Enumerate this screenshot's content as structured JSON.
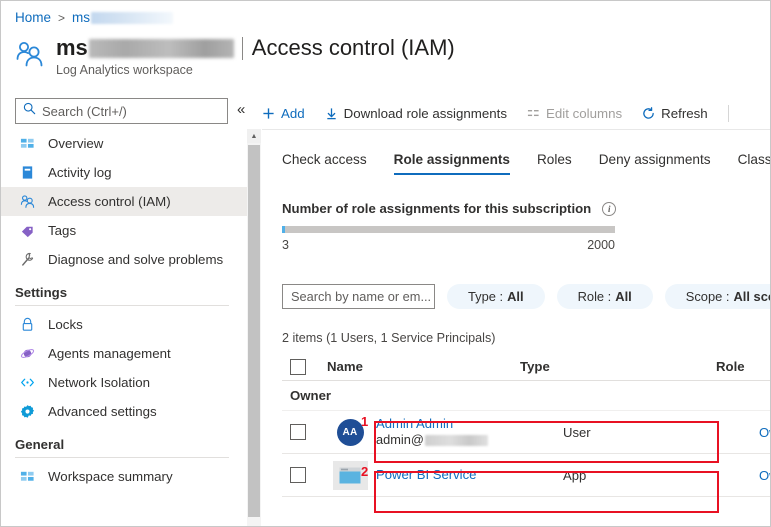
{
  "breadcrumb": {
    "home": "Home",
    "separator": ">",
    "current_prefix": "ms",
    "current_redacted": true
  },
  "header": {
    "icon": "people-icon",
    "resource_prefix": "ms",
    "resource_redacted": true,
    "separator": "|",
    "section": "Access control (IAM)",
    "subtitle": "Log Analytics workspace"
  },
  "search": {
    "placeholder": "Search (Ctrl+/)",
    "icon": "search-icon",
    "collapse": "«"
  },
  "sidebar": {
    "items": [
      {
        "label": "Overview",
        "icon": "overview-icon",
        "color": "#50b0e8",
        "selected": false
      },
      {
        "label": "Activity log",
        "icon": "activity-log-icon",
        "color": "#2b88d8",
        "selected": false
      },
      {
        "label": "Access control (IAM)",
        "icon": "people-icon",
        "color": "#2b88d8",
        "selected": true
      },
      {
        "label": "Tags",
        "icon": "tag-icon",
        "color": "#8661c5",
        "selected": false
      },
      {
        "label": "Diagnose and solve problems",
        "icon": "wrench-icon",
        "color": "#6b6b6b",
        "selected": false
      }
    ],
    "groups": [
      {
        "title": "Settings",
        "items": [
          {
            "label": "Locks",
            "icon": "lock-icon",
            "color": "#2b88d8"
          },
          {
            "label": "Agents management",
            "icon": "agents-icon",
            "color": "#8661c5"
          },
          {
            "label": "Network Isolation",
            "icon": "network-isolation-icon",
            "color": "#00a4ef"
          },
          {
            "label": "Advanced settings",
            "icon": "gear-icon",
            "color": "#0f9bd7"
          }
        ]
      },
      {
        "title": "General",
        "items": [
          {
            "label": "Workspace summary",
            "icon": "overview-icon",
            "color": "#50b0e8"
          }
        ]
      }
    ]
  },
  "toolbar": {
    "commands": [
      {
        "label": "Add",
        "icon": "plus-icon",
        "accent": true,
        "disabled": false
      },
      {
        "label": "Download role assignments",
        "icon": "download-icon",
        "accent": false,
        "disabled": false
      },
      {
        "label": "Edit columns",
        "icon": "columns-icon",
        "accent": false,
        "disabled": true
      },
      {
        "label": "Refresh",
        "icon": "refresh-icon",
        "accent": false,
        "disabled": false
      }
    ]
  },
  "tabs": [
    {
      "label": "Check access",
      "active": false
    },
    {
      "label": "Role assignments",
      "active": true
    },
    {
      "label": "Roles",
      "active": false
    },
    {
      "label": "Deny assignments",
      "active": false
    },
    {
      "label": "Classic",
      "active": false
    }
  ],
  "counter": {
    "title": "Number of role assignments for this subscription",
    "info_icon": "info-icon",
    "current": "3",
    "max": "2000",
    "fill_color": "#50b0e8",
    "track_color": "#c8c6c4"
  },
  "filters": {
    "search_placeholder": "Search by name or em...",
    "pills": [
      {
        "label": "Type :",
        "value": "All"
      },
      {
        "label": "Role :",
        "value": "All"
      },
      {
        "label": "Scope :",
        "value": "All scopes"
      }
    ]
  },
  "table": {
    "item_count": "2 items (1 Users, 1 Service Principals)",
    "columns": [
      "Name",
      "Type",
      "Role"
    ],
    "group_label": "Owner",
    "rows": [
      {
        "avatar_type": "initials",
        "avatar_initials": "AA",
        "avatar_color": "#1f4e96",
        "name": "Admin Admin",
        "email_prefix": "admin@",
        "email_redacted": true,
        "type": "User",
        "role": "Owner",
        "info_icon": "info-icon",
        "annotation": "1"
      },
      {
        "avatar_type": "app",
        "avatar_icon": "app-window-icon",
        "avatar_color": "#5ab3e0",
        "name": "Power BI Service",
        "email_prefix": "",
        "email_redacted": false,
        "type": "App",
        "role": "Owner",
        "info_icon": "info-icon",
        "annotation": "2"
      }
    ]
  },
  "annotation_color": "#e81123"
}
